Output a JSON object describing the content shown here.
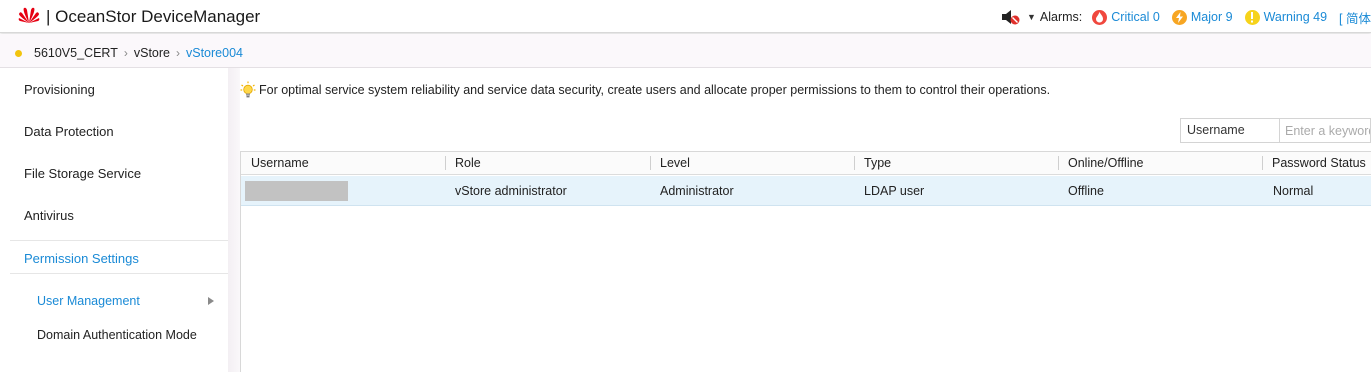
{
  "header": {
    "brand": "HUAWEI",
    "title": "| OceanStor DeviceManager",
    "alarms_label": "Alarms:",
    "alarms": [
      {
        "label": "Critical 0",
        "icon": "critical-alarm-icon",
        "color": "#f0483e"
      },
      {
        "label": "Major 9",
        "icon": "major-alarm-icon",
        "color": "#f7a623"
      },
      {
        "label": "Warning 49",
        "icon": "warning-alarm-icon",
        "color": "#f6d31b"
      }
    ],
    "language": "[ 简体"
  },
  "breadcrumb": {
    "items": [
      "5610V5_CERT",
      "vStore",
      "vStore004"
    ]
  },
  "nav": {
    "items": [
      "Provisioning",
      "Data Protection",
      "File Storage Service",
      "Antivirus",
      "Permission Settings"
    ],
    "sub_items": [
      "User Management",
      "Domain Authentication Mode"
    ]
  },
  "main": {
    "tip": "For optimal service system reliability and service data security, create users and allocate proper permissions to them to control their operations.",
    "search": {
      "field": "Username",
      "placeholder": "Enter a keyword"
    },
    "table": {
      "columns": [
        "Username",
        "Role",
        "Level",
        "Type",
        "Online/Offline",
        "Password Status"
      ],
      "rows": [
        {
          "username": "",
          "role": "vStore administrator",
          "level": "Administrator",
          "type": "LDAP user",
          "online": "Offline",
          "password_status": "Normal"
        }
      ]
    }
  },
  "colors": {
    "accent": "#1a8ad6",
    "selected_row": "#e6f3fb",
    "status_dot": "#f2c40e"
  }
}
